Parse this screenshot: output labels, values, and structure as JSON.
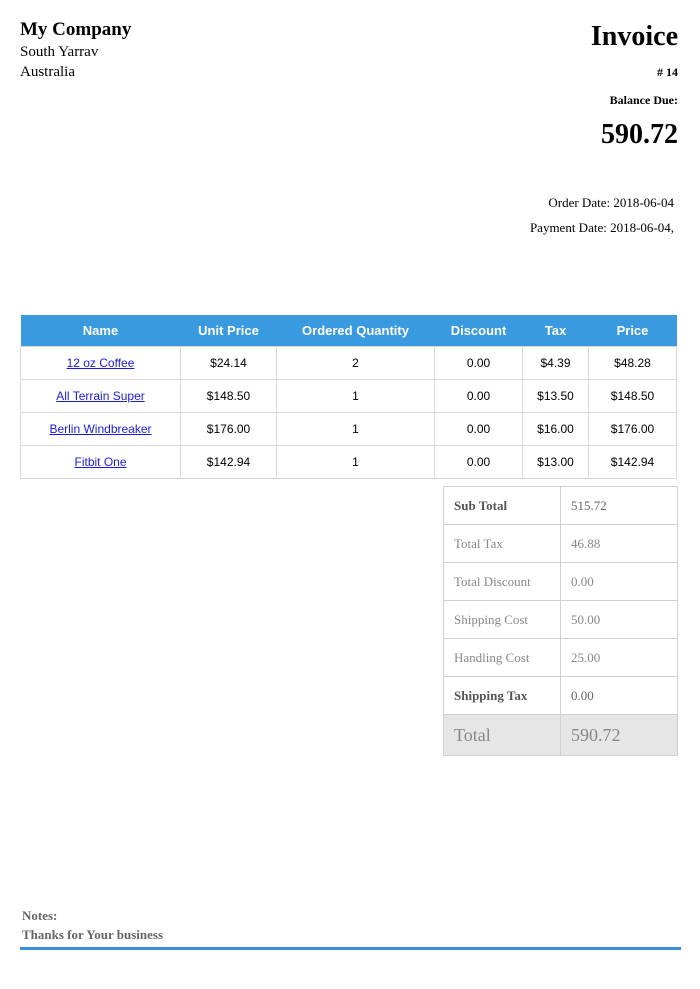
{
  "company": {
    "name": "My Company",
    "address_line1": "South Yarrav",
    "address_line2": "Australia"
  },
  "invoice": {
    "title": "Invoice",
    "number": "# 14",
    "balance_label": "Balance Due:",
    "balance_value": "590.72",
    "order_date": "Order Date: 2018-06-04",
    "payment_date": "Payment Date: 2018-06-04,"
  },
  "items_table": {
    "headers": [
      "Name",
      "Unit Price",
      "Ordered Quantity",
      "Discount",
      "Tax",
      "Price"
    ],
    "rows": [
      [
        "12 oz Coffee",
        "$24.14",
        "2",
        "0.00",
        "$4.39",
        "$48.28"
      ],
      [
        "All Terrain Super",
        "$148.50",
        "1",
        "0.00",
        "$13.50",
        "$148.50"
      ],
      [
        "Berlin Windbreaker",
        "$176.00",
        "1",
        "0.00",
        "$16.00",
        "$176.00"
      ],
      [
        "Fitbit One",
        "$142.94",
        "1",
        "0.00",
        "$13.00",
        "$142.94"
      ]
    ]
  },
  "totals": {
    "sub_total_label": "Sub Total",
    "sub_total": "515.72",
    "total_tax_label": "Total Tax",
    "total_tax": "46.88",
    "total_discount_label": "Total Discount",
    "total_discount": "0.00",
    "shipping_cost_label": "Shipping Cost",
    "shipping_cost": "50.00",
    "handling_cost_label": "Handling Cost",
    "handling_cost": "25.00",
    "shipping_tax_label": "Shipping Tax",
    "shipping_tax": "0.00",
    "total_label": "Total",
    "total": "590.72"
  },
  "notes": {
    "label": "Notes:",
    "text": "Thanks for Your business"
  },
  "colors": {
    "accent": "#3a9ae0",
    "link": "#1a1ae6",
    "total_bg": "#e6e6e6"
  }
}
